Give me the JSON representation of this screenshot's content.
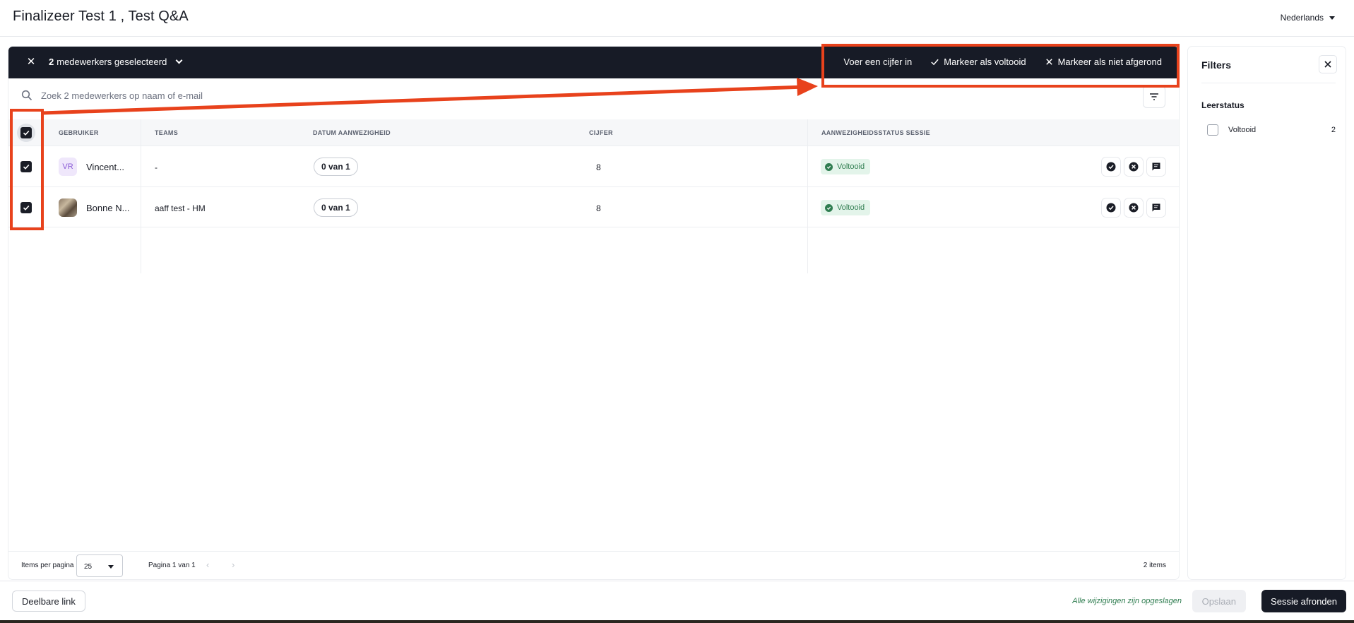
{
  "header": {
    "title": "Finalizeer Test 1 , Test Q&A",
    "language": "Nederlands"
  },
  "selection_bar": {
    "count": "2",
    "count_suffix": "medewerkers geselecteerd",
    "actions": {
      "enter_grade": "Voer een cijfer in",
      "mark_complete": "Markeer als voltooid",
      "mark_incomplete": "Markeer als niet afgerond"
    }
  },
  "search": {
    "placeholder": "Zoek 2 medewerkers op naam of e-mail"
  },
  "table": {
    "columns": {
      "user": "GEBRUIKER",
      "teams": "TEAMS",
      "date": "DATUM AANWEZIGHEID",
      "grade": "CIJFER",
      "status": "AANWEZIGHEIDSSTATUS SESSIE"
    },
    "rows": [
      {
        "initials": "VR",
        "name": "Vincent...",
        "teams": "-",
        "date": "0 van 1",
        "grade": "8",
        "status": "Voltooid",
        "checked": true
      },
      {
        "initials": "",
        "name": "Bonne N...",
        "teams": "aaff test - HM",
        "date": "0 van 1",
        "grade": "8",
        "status": "Voltooid",
        "checked": true
      }
    ]
  },
  "pagination": {
    "items_per_page_label": "Items per pagina",
    "items_per_page": "25",
    "page_label": "Pagina 1 van 1",
    "item_count": "2 items"
  },
  "filters": {
    "title": "Filters",
    "section": "Leerstatus",
    "options": [
      {
        "label": "Voltooid",
        "count": "2"
      }
    ]
  },
  "footer": {
    "share_link": "Deelbare link",
    "saved_message": "Alle wijzigingen zijn opgeslagen",
    "save": "Opslaan",
    "finish": "Sessie afronden"
  },
  "colors": {
    "dark": "#171b26",
    "annotation": "#e8421c",
    "success": "#2f7d50",
    "success_bg": "#e3f4ea"
  }
}
